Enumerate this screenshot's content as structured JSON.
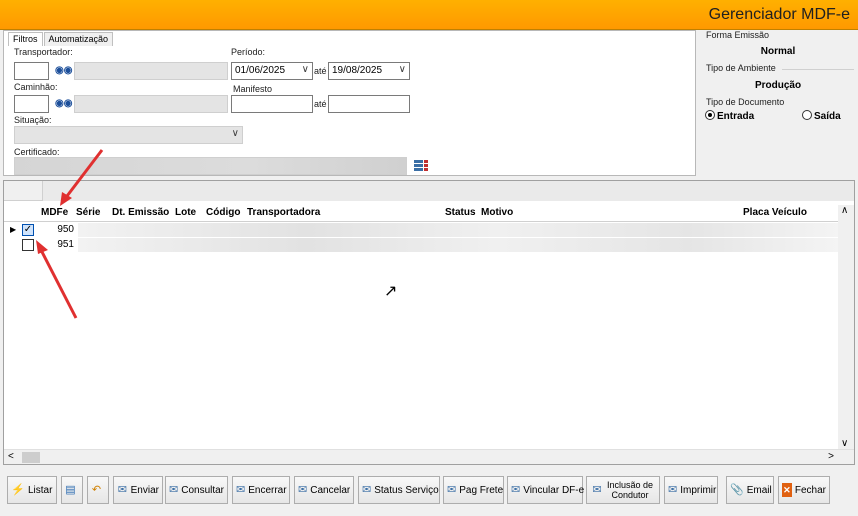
{
  "window": {
    "title": "Gerenciador MDF-e"
  },
  "filters": {
    "tabs": [
      "Filtros",
      "Automatização"
    ],
    "transportador_label": "Transportador:",
    "periodo_label": "Período:",
    "periodo_inicio": "01/06/2025",
    "ate_label": "até",
    "periodo_fim": "19/08/2025",
    "caminhao_label": "Caminhão:",
    "manifesto_label": "Manifesto",
    "ate2_label": "até",
    "situacao_label": "Situação:",
    "certificado_label": "Certificado:"
  },
  "right_panel": {
    "forma_emissao_label": "Forma Emissão",
    "forma_emissao_value": "Normal",
    "tipo_ambiente_label": "Tipo de Ambiente",
    "tipo_ambiente_value": "Produção",
    "tipo_documento_label": "Tipo de Documento",
    "entrada_label": "Entrada",
    "saida_label": "Saída",
    "selected": "Entrada"
  },
  "grid": {
    "columns": [
      "MDFe",
      "Série",
      "Dt. Emissão",
      "Lote",
      "Código",
      "Transportadora",
      "Status",
      "Motivo",
      "Placa Veículo"
    ],
    "rows": [
      {
        "mdfe": "950",
        "checked": true
      },
      {
        "mdfe": "951",
        "checked": false
      }
    ]
  },
  "toolbar": {
    "listar": "Listar",
    "enviar": "Enviar",
    "consultar": "Consultar",
    "encerrar": "Encerrar",
    "cancelar": "Cancelar",
    "status_servico": "Status Serviço",
    "pag_frete": "Pag Frete",
    "vincular": "Vincular DF-e",
    "inclusao_1": "Inclusão de",
    "inclusao_2": "Condutor",
    "imprimir": "Imprimir",
    "email": "Email",
    "fechar": "Fechar"
  },
  "colors": {
    "title_bar": "#ff9900",
    "annotation_arrow": "#e03030"
  }
}
